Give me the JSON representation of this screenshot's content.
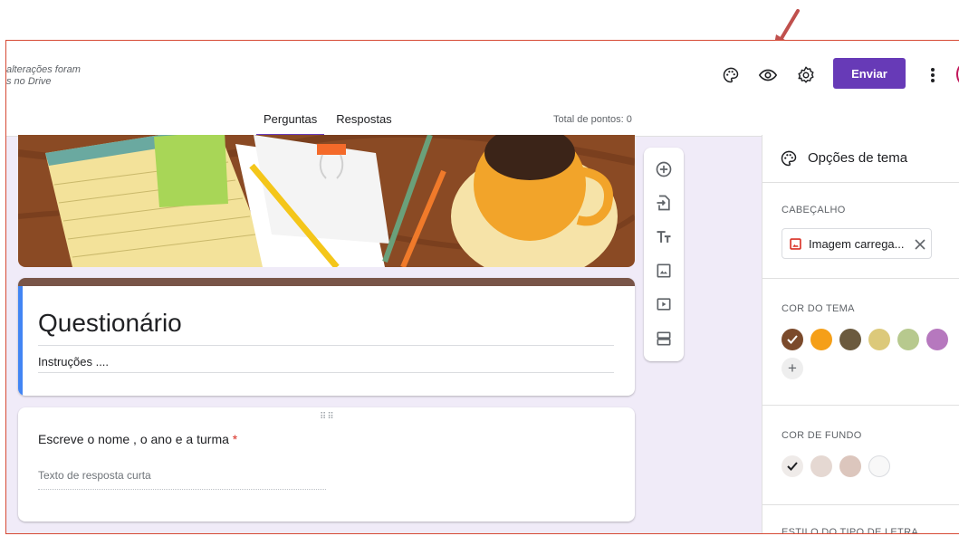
{
  "header": {
    "save_status_line1": "alterações foram",
    "save_status_line2": "s no Drive",
    "send_label": "Enviar",
    "tabs": [
      {
        "label": "Perguntas",
        "active": true
      },
      {
        "label": "Respostas",
        "active": false
      }
    ],
    "total_points": "Total de pontos: 0",
    "icons": [
      "palette-icon",
      "eye-icon",
      "gear-icon",
      "more-vert-icon"
    ]
  },
  "form": {
    "title": "Questionário",
    "description": "Instruções ....",
    "question": {
      "text": "Escreve o nome , o ano e a turma",
      "required_mark": "*",
      "answer_placeholder": "Texto de resposta curta"
    }
  },
  "toolbar": {
    "tools": [
      "add-question-icon",
      "import-questions-icon",
      "add-title-icon",
      "add-image-icon",
      "add-video-icon",
      "add-section-icon"
    ]
  },
  "theme_panel": {
    "title": "Opções de tema",
    "header_section_label": "CABEÇALHO",
    "header_image_chip": "Imagem carrega...",
    "theme_color_label": "COR DO TEMA",
    "theme_colors": [
      "#7b4a2b",
      "#f59f18",
      "#6b5a3e",
      "#dcc97a",
      "#b7c98e",
      "#b678be"
    ],
    "selected_theme_color": "#7b4a2b",
    "background_color_label": "COR DE FUNDO",
    "background_colors": [
      "#efebe9",
      "#e5d8d2",
      "#dcc6bd",
      "#f8f8f8"
    ],
    "font_style_label": "ESTILO DO TIPO DE LETRA"
  },
  "colors": {
    "accent": "#673ab7",
    "highlight_border": "#d64a35"
  }
}
